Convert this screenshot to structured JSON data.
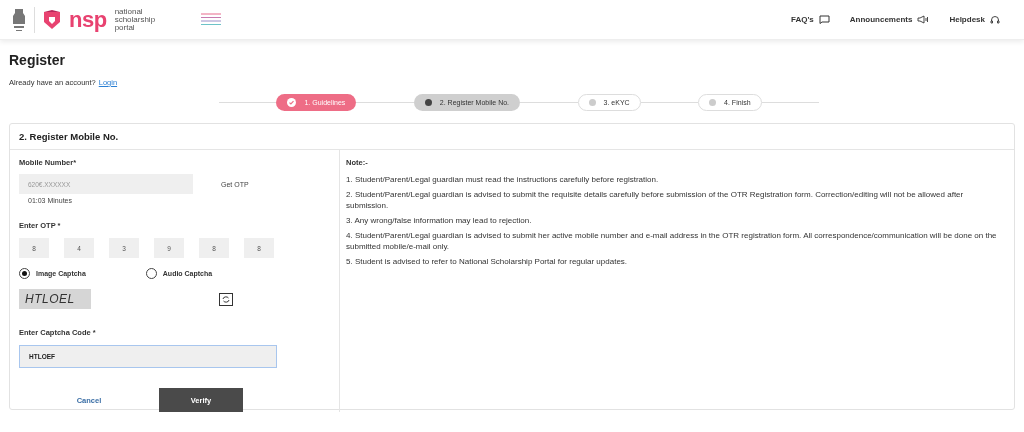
{
  "header": {
    "logo_word": "nsp",
    "logo_tagline": "national scholarship portal",
    "links": [
      {
        "label": "FAQ's"
      },
      {
        "label": "Announcements"
      },
      {
        "label": "Helpdesk"
      }
    ]
  },
  "page": {
    "title": "Register",
    "account_prompt": "Already have an account?",
    "login_link": "Login"
  },
  "steps": [
    {
      "label": "1. Guidelines",
      "completed": true,
      "selected": false
    },
    {
      "label": "2. Register Mobile No.",
      "completed": false,
      "selected": true
    },
    {
      "label": "3. eKYC",
      "completed": false,
      "selected": false
    },
    {
      "label": "4. Finish",
      "completed": false,
      "selected": false
    }
  ],
  "card": {
    "title": "2. Register Mobile No.",
    "mobile": {
      "label": "Mobile Number*",
      "value": "620€.XXXXXX",
      "action": "Get OTP",
      "timer": "01:03 Minutes"
    },
    "otp": {
      "label": "Enter OTP *",
      "digits": [
        "8",
        "4",
        "3",
        "9",
        "8",
        "8"
      ]
    },
    "captcha_types": [
      {
        "label": "Image Captcha",
        "selected": true
      },
      {
        "label": "Audio Captcha",
        "selected": false
      }
    ],
    "captcha_image_text": "HTLOEL",
    "captcha_input": {
      "label": "Enter Captcha Code *",
      "value": "HTLOEF"
    },
    "buttons": [
      {
        "label": "Cancel",
        "kind": "link"
      },
      {
        "label": "Verify",
        "kind": "primary"
      }
    ],
    "note": {
      "title": "Note:-",
      "items": [
        "1. Student/Parent/Legal guardian must read the instructions carefully before registration.",
        "2. Student/Parent/Legal guardian is advised to submit the requisite details carefully before submission of the OTR Registration form. Correction/editing will not be allowed after submission.",
        "3. Any wrong/false information may lead to rejection.",
        "4. Student/Parent/Legal guardian is advised to submit her active mobile number and e-mail address in the OTR registration form. All correspondence/communication will be done on the submitted mobile/e-mail only.",
        "5. Student is advised to refer to National Scholarship Portal for regular updates."
      ]
    }
  }
}
